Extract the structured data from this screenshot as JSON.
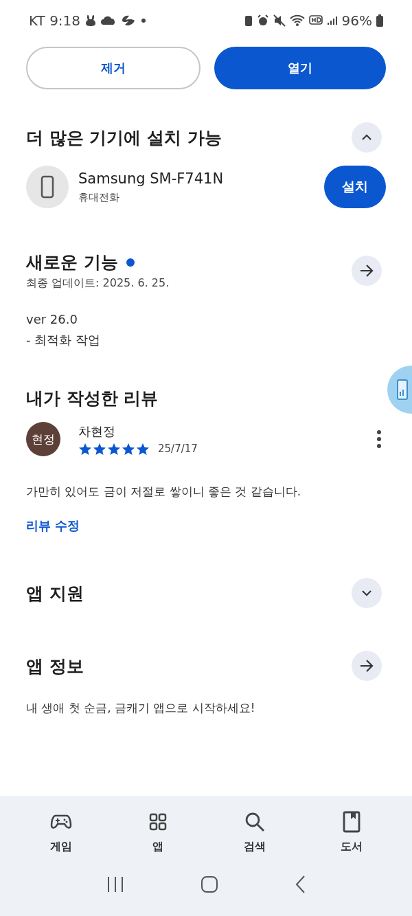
{
  "status_bar": {
    "carrier": "KT",
    "time": "9:18",
    "battery": "96%"
  },
  "actions": [
    {
      "label": "제거",
      "kind": "outline"
    },
    {
      "label": "열기",
      "kind": "filled"
    }
  ],
  "devices_section": {
    "title": "더 많은 기기에 설치 가능",
    "expanded": true,
    "device": {
      "name": "Samsung SM-F741N",
      "type": "휴대전화",
      "button": "설치"
    }
  },
  "whats_new": {
    "title": "새로운 기능",
    "new": true,
    "updated": "최종 업데이트: 2025. 6. 25.",
    "notes": [
      "ver 26.0",
      "- 최적화 작업"
    ]
  },
  "my_review": {
    "title": "내가 작성한 리뷰",
    "avatar": "현정",
    "author": "차현정",
    "stars": 5,
    "date": "25/7/17",
    "text": "가만히 있어도 금이 저절로 쌓이니 좋은 것 같습니다.",
    "edit_link": "리뷰 수정"
  },
  "app_support": {
    "title": "앱 지원",
    "expanded": false
  },
  "app_info": {
    "title": "앱 정보",
    "description": "내 생애 첫 순금, 금캐기 앱으로 시작하세요!"
  },
  "nav_tabs": [
    {
      "label": "게임",
      "kind": "games",
      "selected": false
    },
    {
      "label": "앱",
      "kind": "apps",
      "selected": false
    },
    {
      "label": "검색",
      "kind": "search",
      "selected": false
    },
    {
      "label": "도서",
      "kind": "books",
      "selected": false
    }
  ]
}
